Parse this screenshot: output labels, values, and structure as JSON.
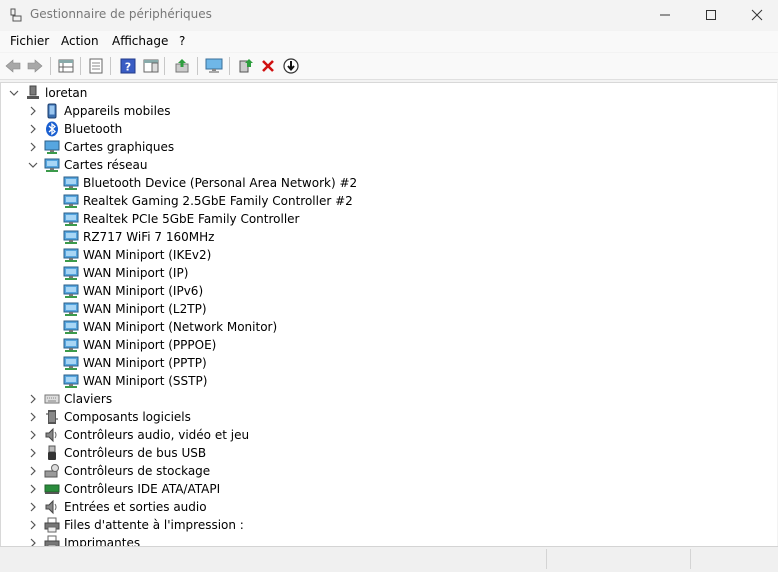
{
  "window": {
    "title": "Gestionnaire de périphériques"
  },
  "menu": [
    "Fichier",
    "Action",
    "Affichage",
    "?"
  ],
  "toolbar": [
    {
      "name": "back-arrow-icon",
      "icon": "arrow-left"
    },
    {
      "name": "forward-arrow-icon",
      "icon": "arrow-right"
    },
    {
      "name": "properties-grid-icon",
      "icon": "grid"
    },
    {
      "name": "details-page-icon",
      "icon": "page"
    },
    {
      "name": "help-icon",
      "icon": "help"
    },
    {
      "name": "action-pane-icon",
      "icon": "pane"
    },
    {
      "name": "update-driver-icon",
      "icon": "update"
    },
    {
      "name": "scan-hardware-monitor-icon",
      "icon": "monitor"
    },
    {
      "name": "enable-device-icon",
      "icon": "enable"
    },
    {
      "name": "uninstall-x-icon",
      "icon": "x"
    },
    {
      "name": "download-circle-icon",
      "icon": "download"
    }
  ],
  "tree": {
    "root": {
      "label": "loretan",
      "icon": "computer"
    },
    "categories": [
      {
        "label": "Appareils mobiles",
        "icon": "phone",
        "expanded": false
      },
      {
        "label": "Bluetooth",
        "icon": "bluetooth",
        "expanded": false
      },
      {
        "label": "Cartes graphiques",
        "icon": "display",
        "expanded": false
      },
      {
        "label": "Cartes réseau",
        "icon": "network",
        "expanded": true,
        "children": [
          "Bluetooth Device (Personal Area Network) #2",
          "Realtek Gaming 2.5GbE Family Controller #2",
          "Realtek PCIe 5GbE Family Controller",
          "RZ717 WiFi 7 160MHz",
          "WAN Miniport (IKEv2)",
          "WAN Miniport (IP)",
          "WAN Miniport (IPv6)",
          "WAN Miniport (L2TP)",
          "WAN Miniport (Network Monitor)",
          "WAN Miniport (PPPOE)",
          "WAN Miniport (PPTP)",
          "WAN Miniport (SSTP)"
        ]
      },
      {
        "label": "Claviers",
        "icon": "keyboard",
        "expanded": false
      },
      {
        "label": "Composants logiciels",
        "icon": "component",
        "expanded": false
      },
      {
        "label": "Contrôleurs audio, vidéo et jeu",
        "icon": "speaker",
        "expanded": false
      },
      {
        "label": "Contrôleurs de bus USB",
        "icon": "usb",
        "expanded": false
      },
      {
        "label": "Contrôleurs de stockage",
        "icon": "storage",
        "expanded": false
      },
      {
        "label": "Contrôleurs IDE ATA/ATAPI",
        "icon": "ide",
        "expanded": false
      },
      {
        "label": "Entrées et sorties audio",
        "icon": "speaker",
        "expanded": false
      },
      {
        "label": "Files d'attente à l'impression :",
        "icon": "printer",
        "expanded": false
      },
      {
        "label": "Imprimantes",
        "icon": "printer",
        "expanded": false
      }
    ]
  }
}
